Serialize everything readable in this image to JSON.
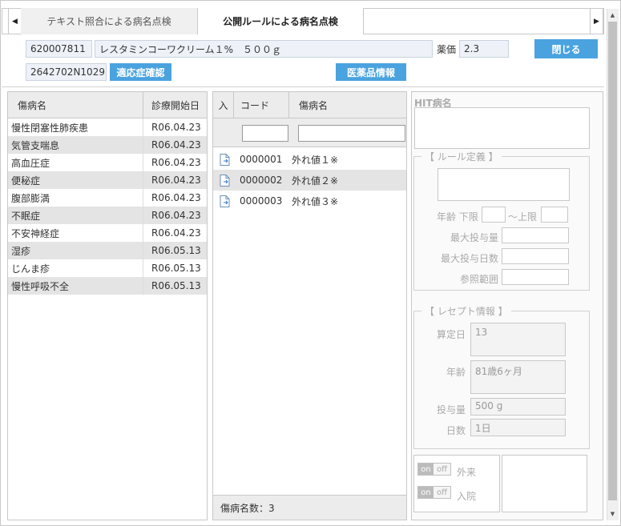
{
  "tabs": [
    {
      "label": "テキスト照合による病名点検"
    },
    {
      "label": "公開ルールによる病名点検"
    }
  ],
  "header": {
    "drug_code": "620007811",
    "drug_name": "レスタミンコーワクリーム１%　５００ｇ",
    "price_label": "薬価",
    "price_value": "2.3",
    "close_label": "閉じる",
    "receipt_code": "2642702N1029",
    "indication_label": "適応症確認",
    "drug_info_label": "医薬品情報"
  },
  "left_table": {
    "headers": [
      "傷病名",
      "診療開始日"
    ],
    "rows": [
      {
        "name": "慢性閉塞性肺疾患",
        "date": "R06.04.23"
      },
      {
        "name": "気管支喘息",
        "date": "R06.04.23"
      },
      {
        "name": "高血圧症",
        "date": "R06.04.23"
      },
      {
        "name": "便秘症",
        "date": "R06.04.23"
      },
      {
        "name": "腹部膨満",
        "date": "R06.04.23"
      },
      {
        "name": "不眠症",
        "date": "R06.04.23"
      },
      {
        "name": "不安神経症",
        "date": "R06.04.23"
      },
      {
        "name": "湿疹",
        "date": "R06.05.13"
      },
      {
        "name": "じんま疹",
        "date": "R06.05.13"
      },
      {
        "name": "慢性呼吸不全",
        "date": "R06.05.13"
      }
    ]
  },
  "mid_table": {
    "headers": [
      "入",
      "コード",
      "傷病名"
    ],
    "rows": [
      {
        "code": "0000001",
        "name": "外れ値１※"
      },
      {
        "code": "0000002",
        "name": "外れ値２※"
      },
      {
        "code": "0000003",
        "name": "外れ値３※"
      }
    ],
    "footer": "傷病名数：3"
  },
  "right_panel": {
    "hit_label": "HIT病名",
    "rule_legend": "【 ルール定義 】",
    "age_label": "年齢 下限",
    "age_upper_label": "～上限",
    "max_dose_label": "最大投与量",
    "max_days_label": "最大投与日数",
    "ref_range_label": "参照範囲",
    "receipt_legend": "【 レセプト情報 】",
    "calc_date_label": "算定日",
    "calc_date_value": "13",
    "age2_label": "年齢",
    "age2_value": "81歳6ヶ月",
    "dose_label": "投与量",
    "dose_value": "500 g",
    "days_label": "日数",
    "days_value": "1日",
    "outpatient_label": "外来",
    "inpatient_label": "入院",
    "toggle_on": "on",
    "toggle_off": "off"
  }
}
